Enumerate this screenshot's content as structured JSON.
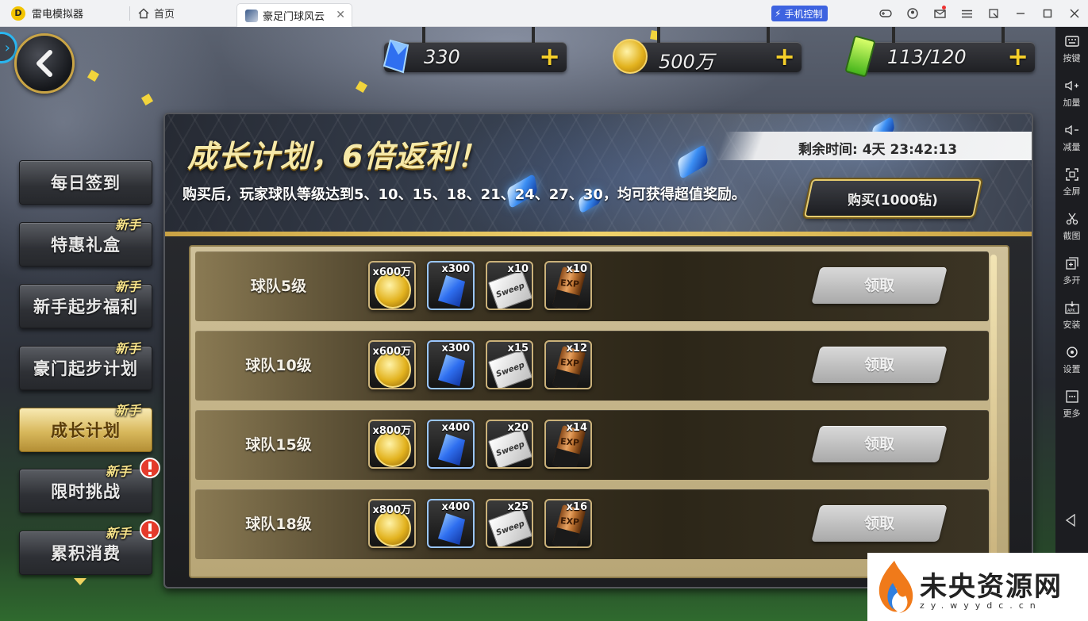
{
  "titlebar": {
    "app_name": "雷电模拟器",
    "home_tab": "首页",
    "game_tab": "豪足门球风云",
    "phone_control": "手机控制"
  },
  "sidebar": {
    "items": [
      {
        "label": "按键",
        "icon": "keyboard-icon"
      },
      {
        "label": "加量",
        "icon": "volume-up-icon"
      },
      {
        "label": "减量",
        "icon": "volume-down-icon"
      },
      {
        "label": "全屏",
        "icon": "fullscreen-icon"
      },
      {
        "label": "截图",
        "icon": "scissors-icon"
      },
      {
        "label": "多开",
        "icon": "multi-instance-icon"
      },
      {
        "label": "安装",
        "icon": "apk-install-icon"
      },
      {
        "label": "设置",
        "icon": "gear-icon"
      },
      {
        "label": "更多",
        "icon": "more-icon"
      }
    ]
  },
  "currency": {
    "diamonds": "330",
    "coins": "500万",
    "stamina": "113/120"
  },
  "menu": {
    "items": [
      {
        "label": "每日签到",
        "badge": ""
      },
      {
        "label": "特惠礼盒",
        "badge": "新手"
      },
      {
        "label": "新手起步福利",
        "badge": "新手"
      },
      {
        "label": "豪门起步计划",
        "badge": "新手"
      },
      {
        "label": "成长计划",
        "badge": "新手"
      },
      {
        "label": "限时挑战",
        "badge": "新手"
      },
      {
        "label": "累积消费",
        "badge": "新手"
      }
    ]
  },
  "banner": {
    "title": "成长计划，6倍返利！",
    "description": "购买后，玩家球队等级达到5、10、15、18、21、24、27、30，均可获得超值奖励。",
    "timer": "剩余时间: 4天 23:42:13",
    "buy_label": "购买(1000钻)"
  },
  "rows": [
    {
      "label": "球队5级",
      "coins": "x600万",
      "gems": "x300",
      "sweep": "x10",
      "exp": "x10",
      "claim": "领取"
    },
    {
      "label": "球队10级",
      "coins": "x600万",
      "gems": "x300",
      "sweep": "x15",
      "exp": "x12",
      "claim": "领取"
    },
    {
      "label": "球队15级",
      "coins": "x800万",
      "gems": "x400",
      "sweep": "x20",
      "exp": "x14",
      "claim": "领取"
    },
    {
      "label": "球队18级",
      "coins": "x800万",
      "gems": "x400",
      "sweep": "x25",
      "exp": "x16",
      "claim": "领取"
    }
  ],
  "item_text": {
    "sweep": "Sweep",
    "exp": "EXP"
  },
  "watermark": {
    "text": "未央资源网",
    "sub": "zy.wyydc.cn"
  },
  "colors": {
    "accent_gold": "#f0d36b",
    "phone_control_blue": "#3d63e0",
    "active_menu": "#d8b85c"
  }
}
